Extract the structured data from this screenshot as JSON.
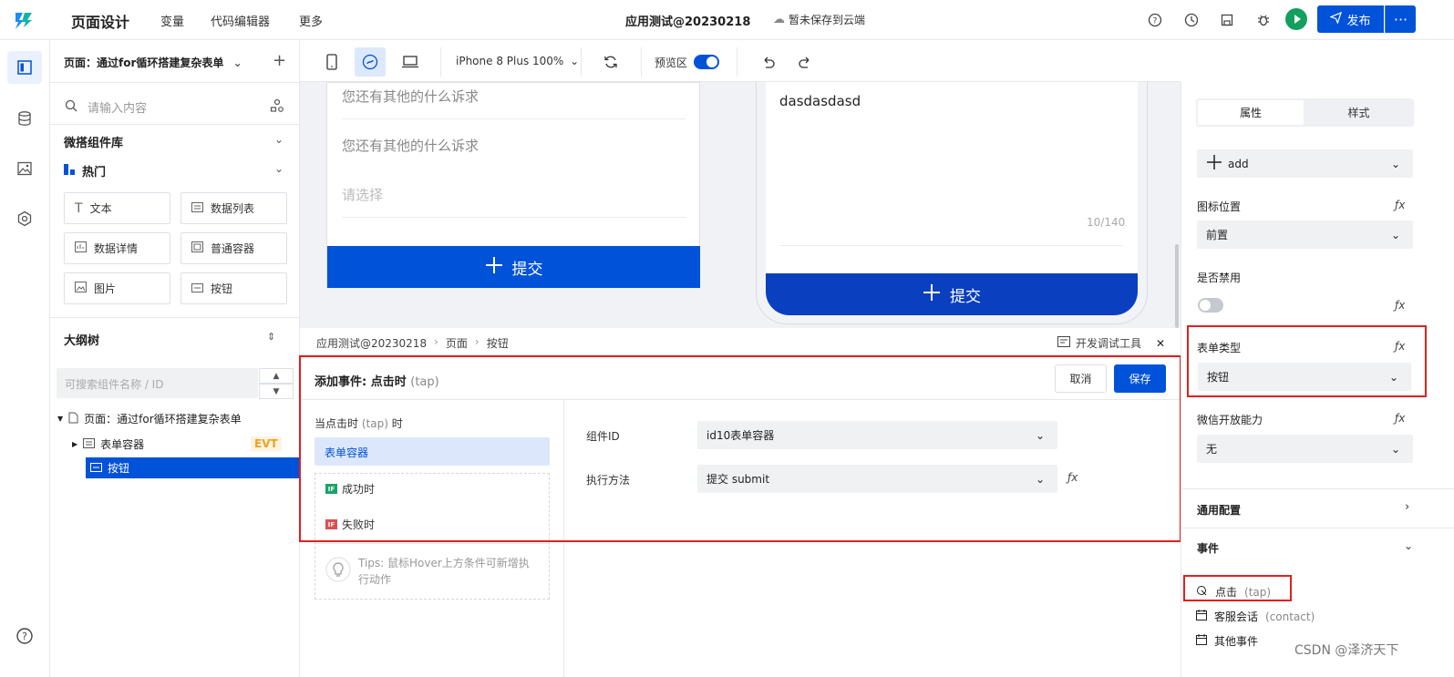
{
  "topbar": {
    "title": "页面设计",
    "menu": [
      "变量",
      "代码编辑器",
      "更多"
    ],
    "app_name": "应用测试@20230218",
    "save_state": "暂未保存到云端",
    "publish_label": "发布",
    "more_label": "···"
  },
  "left_panel": {
    "page_selector": "页面：通过for循环搭建复杂表单",
    "add_label": "+",
    "search_placeholder": "请输入内容",
    "library_title": "微搭组件库",
    "hot_title": "热门",
    "components": [
      "文本",
      "数据列表",
      "数据详情",
      "普通容器",
      "图片",
      "按钮"
    ],
    "outline_title": "大纲树",
    "outline_search_placeholder": "可搜索组件名称 / ID",
    "tree": {
      "root": "页面：通过for循环搭建复杂表单",
      "child": "表单容器",
      "child_badge": "EVT",
      "selected": "按钮"
    }
  },
  "toolbar": {
    "device": "iPhone 8 Plus 100%",
    "preview_label": "预览区",
    "preview_on": true
  },
  "canvas": {
    "phone1": {
      "field1": "您还有其他的什么诉求",
      "field2": "您还有其他的什么诉求",
      "field3": "请选择",
      "submit": "提交"
    },
    "phone2": {
      "text": "dasdasdasd",
      "counter": "10/140",
      "submit": "提交"
    }
  },
  "breadcrumb": {
    "items": [
      "应用测试@20230218",
      "页面",
      "按钮"
    ],
    "separator": "›",
    "devtools": "开发调试工具",
    "close": "✕"
  },
  "event_panel": {
    "title": "添加事件: 点击时",
    "title_tap": "(tap)",
    "cancel": "取消",
    "save": "保存",
    "when_prefix": "当点击时",
    "when_tap": "(tap)",
    "when_suffix": "时",
    "target": "表单容器",
    "success": "成功时",
    "fail": "失败时",
    "if_badge": "IF",
    "tips": "Tips: 鼠标Hover上方条件可新增执行动作",
    "component_id_label": "组件ID",
    "component_id_value": "id10表单容器",
    "method_label": "执行方法",
    "method_value": "提交 submit",
    "fx": "ƒx"
  },
  "right_panel": {
    "tab_props": "属性",
    "tab_style": "样式",
    "icon_select": "add",
    "icon_pos_label": "图标位置",
    "icon_pos_value": "前置",
    "disabled_label": "是否禁用",
    "disabled_on": false,
    "form_type_label": "表单类型",
    "form_type_value": "按钮",
    "wechat_label": "微信开放能力",
    "wechat_value": "无",
    "general_config": "通用配置",
    "events_title": "事件",
    "events": [
      {
        "label": "点击",
        "sub": "(tap)"
      },
      {
        "label": "客服会话",
        "sub": "(contact)"
      },
      {
        "label": "其他事件",
        "sub": ""
      }
    ],
    "fx": "ƒx"
  },
  "watermark": "CSDN @泽济天下",
  "colors": {
    "primary": "#0052d9",
    "highlight_box": "#e02020",
    "run_green": "#12a05c"
  }
}
